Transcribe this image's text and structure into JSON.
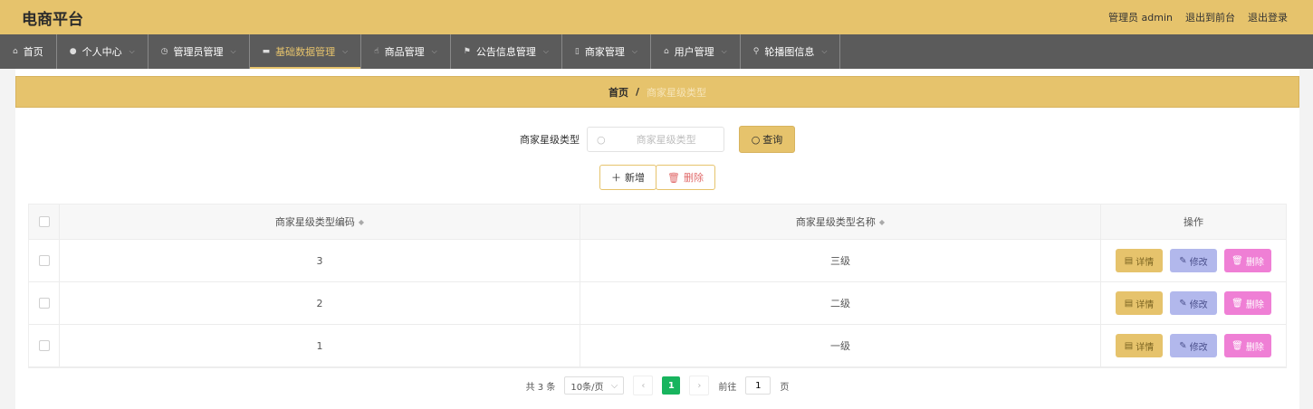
{
  "app": {
    "title": "电商平台",
    "user_label": "管理员 admin",
    "front_link": "退出到前台",
    "logout_link": "退出登录"
  },
  "nav": [
    {
      "label": "首页",
      "icon": "home-icon"
    },
    {
      "label": "个人中心",
      "icon": "person-icon"
    },
    {
      "label": "管理员管理",
      "icon": "clock-icon"
    },
    {
      "label": "基础数据管理",
      "icon": "chat-icon"
    },
    {
      "label": "商品管理",
      "icon": "thumb-icon"
    },
    {
      "label": "公告信息管理",
      "icon": "flag-icon"
    },
    {
      "label": "商家管理",
      "icon": "phone-icon"
    },
    {
      "label": "用户管理",
      "icon": "bank-icon"
    },
    {
      "label": "轮播图信息",
      "icon": "pin-icon"
    }
  ],
  "breadcrumb": {
    "home": "首页",
    "sep": "/",
    "current": "商家星级类型"
  },
  "search": {
    "label": "商家星级类型",
    "placeholder": "商家星级类型",
    "query_label": "查询"
  },
  "actions": {
    "add_label": "新增",
    "delete_label": "删除"
  },
  "table": {
    "columns": {
      "code": "商家星级类型编码",
      "name": "商家星级类型名称",
      "op": "操作"
    },
    "rows": [
      {
        "code": "3",
        "name": "三级"
      },
      {
        "code": "2",
        "name": "二级"
      },
      {
        "code": "1",
        "name": "一级"
      }
    ],
    "op_labels": {
      "detail": "详情",
      "edit": "修改",
      "delete": "删除"
    }
  },
  "pager": {
    "total": "共 3 条",
    "page_size": "10条/页",
    "current": "1",
    "goto_prefix": "前往",
    "goto_value": "1",
    "goto_suffix": "页"
  },
  "colors": {
    "accent": "#e6c36c",
    "nav_bg": "#5b5b5b",
    "detail_btn": "#e6c36c",
    "edit_btn": "#b2b8ec",
    "delete_btn": "#ef7fd5",
    "pager_active": "#18b45e"
  }
}
